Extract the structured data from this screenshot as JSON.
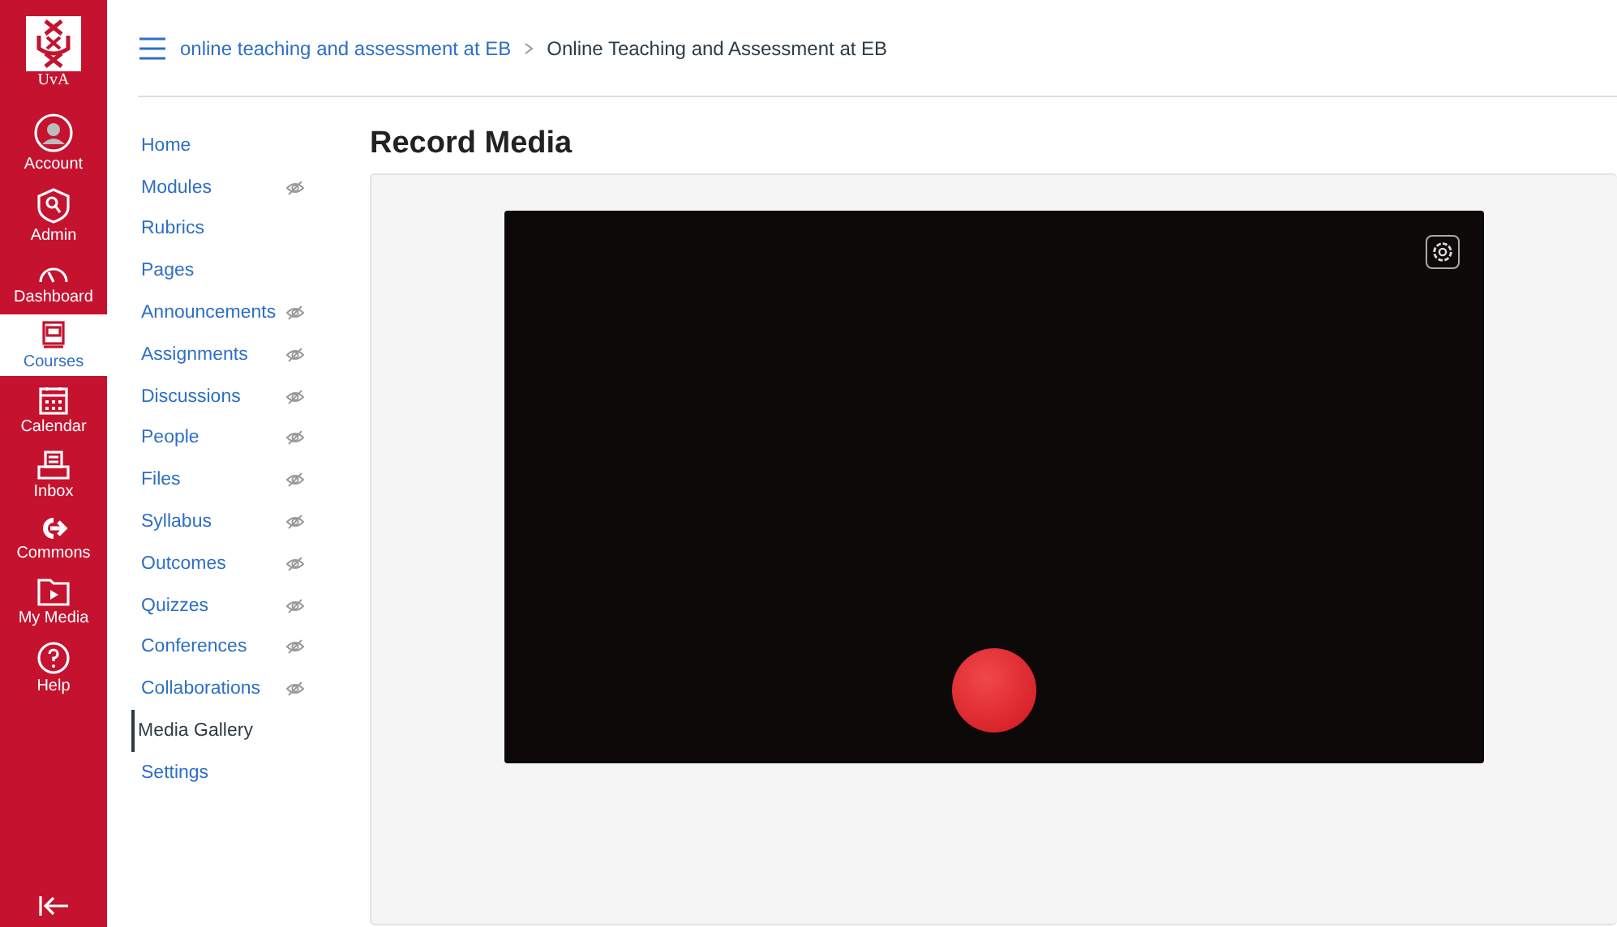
{
  "global_nav": {
    "logo_text": "UvA",
    "items": [
      {
        "label": "Account",
        "kind": "account",
        "selected": false
      },
      {
        "label": "Admin",
        "kind": "admin",
        "selected": false
      },
      {
        "label": "Dashboard",
        "kind": "dashboard",
        "selected": false
      },
      {
        "label": "Courses",
        "kind": "courses",
        "selected": true
      },
      {
        "label": "Calendar",
        "kind": "calendar",
        "selected": false
      },
      {
        "label": "Inbox",
        "kind": "inbox",
        "selected": false
      },
      {
        "label": "Commons",
        "kind": "commons",
        "selected": false
      },
      {
        "label": "My Media",
        "kind": "media",
        "selected": false
      },
      {
        "label": "Help",
        "kind": "help",
        "selected": false
      }
    ]
  },
  "breadcrumb": [
    "online teaching and assessment at EB",
    "Online Teaching and Assessment at EB"
  ],
  "course_nav": [
    {
      "label": "Home",
      "hidden": false,
      "selected": false
    },
    {
      "label": "Modules",
      "hidden": true,
      "selected": false
    },
    {
      "label": "Rubrics",
      "hidden": false,
      "selected": false
    },
    {
      "label": "Pages",
      "hidden": false,
      "selected": false
    },
    {
      "label": "Announcements",
      "hidden": true,
      "selected": false
    },
    {
      "label": "Assignments",
      "hidden": true,
      "selected": false
    },
    {
      "label": "Discussions",
      "hidden": true,
      "selected": false
    },
    {
      "label": "People",
      "hidden": true,
      "selected": false
    },
    {
      "label": "Files",
      "hidden": true,
      "selected": false
    },
    {
      "label": "Syllabus",
      "hidden": true,
      "selected": false
    },
    {
      "label": "Outcomes",
      "hidden": true,
      "selected": false
    },
    {
      "label": "Quizzes",
      "hidden": true,
      "selected": false
    },
    {
      "label": "Conferences",
      "hidden": true,
      "selected": false
    },
    {
      "label": "Collaborations",
      "hidden": true,
      "selected": false
    },
    {
      "label": "Media Gallery",
      "hidden": false,
      "selected": true
    },
    {
      "label": "Settings",
      "hidden": false,
      "selected": false
    }
  ],
  "page_title": "Record Media"
}
